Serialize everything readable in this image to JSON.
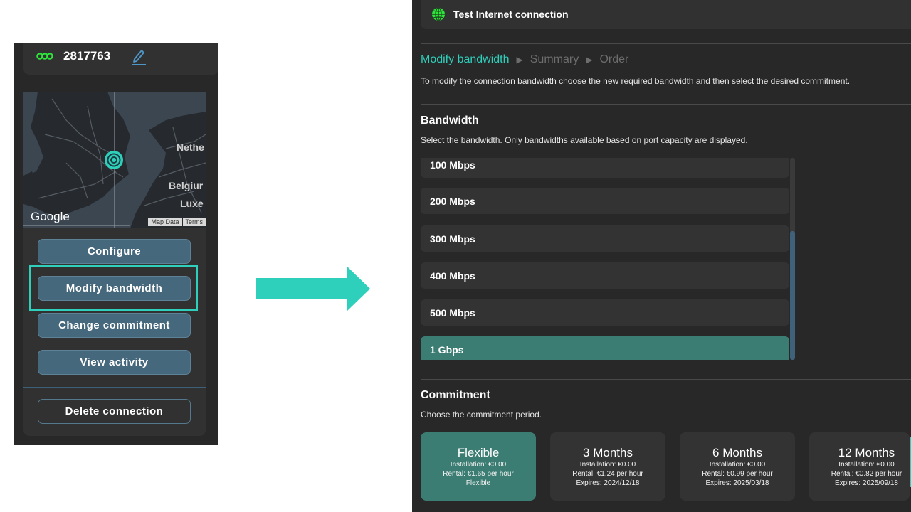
{
  "connection": {
    "id": "2817763",
    "icon": "infinity-link-icon",
    "edit_icon": "pencil-edit-icon"
  },
  "map": {
    "brand": "Google",
    "attribution": [
      "Map Data",
      "Terms"
    ],
    "labels": [
      "Nethe",
      "Belgiur",
      "Luxe"
    ],
    "marker_icon": "location-target-icon"
  },
  "left_actions": {
    "configure": "Configure",
    "modify_bandwidth": "Modify bandwidth",
    "change_commitment": "Change commitment",
    "view_activity": "View activity",
    "delete_connection": "Delete connection"
  },
  "header": {
    "title": "Test Internet connection",
    "icon": "globe-icon"
  },
  "breadcrumb": {
    "steps": [
      "Modify bandwidth",
      "Summary",
      "Order"
    ],
    "active_index": 0
  },
  "intro": "To modify the connection bandwidth choose the new required bandwidth and then select the desired commitment.",
  "bandwidth": {
    "title": "Bandwidth",
    "description": "Select the bandwidth. Only bandwidths available based on port capacity are displayed.",
    "options": [
      "100 Mbps",
      "200 Mbps",
      "300 Mbps",
      "400 Mbps",
      "500 Mbps",
      "1 Gbps"
    ],
    "selected": "1 Gbps"
  },
  "commitment": {
    "title": "Commitment",
    "description": "Choose the commitment period.",
    "options": [
      {
        "title": "Flexible",
        "installation": "Installation: €0.00",
        "rental": "Rental: €1.65 per hour",
        "expires": "Flexible"
      },
      {
        "title": "3 Months",
        "installation": "Installation: €0.00",
        "rental": "Rental: €1.24 per hour",
        "expires": "Expires: 2024/12/18"
      },
      {
        "title": "6 Months",
        "installation": "Installation: €0.00",
        "rental": "Rental: €0.99 per hour",
        "expires": "Expires: 2025/03/18"
      },
      {
        "title": "12 Months",
        "installation": "Installation: €0.00",
        "rental": "Rental: €0.82 per hour",
        "expires": "Expires: 2025/09/18"
      }
    ],
    "selected": "Flexible"
  },
  "colors": {
    "accent": "#2fd0bb",
    "selected_bg": "#3b7d73",
    "button_bg": "#46687d",
    "panel_bg": "#282828",
    "card_bg": "#333333"
  }
}
